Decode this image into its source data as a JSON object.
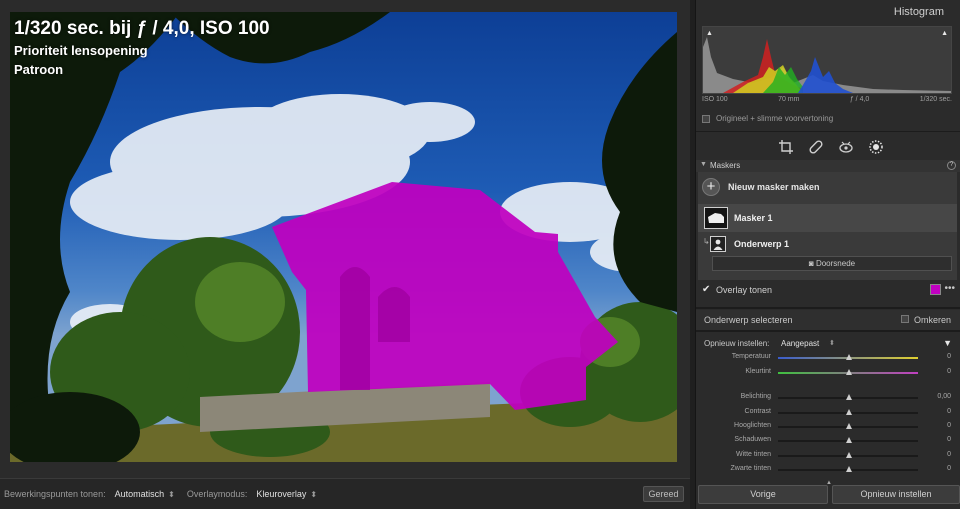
{
  "photo": {
    "exposure": "1/320 sec. bij ƒ / 4,0, ISO 100",
    "mode": "Prioriteit lensopening",
    "pattern": "Patroon",
    "overlay_color": "#c000c0"
  },
  "toolbar": {
    "edit_points_label": "Bewerkingspunten tonen:",
    "edit_points_value": "Automatisch",
    "overlay_mode_label": "Overlaymodus:",
    "overlay_mode_value": "Kleuroverlay",
    "done_label": "Gereed"
  },
  "histogram": {
    "title": "Histogram",
    "iso": "ISO 100",
    "focal": "70 mm",
    "aperture": "ƒ / 4,0",
    "shutter": "1/320 sec.",
    "preview": "Origineel + slimme voorvertoning"
  },
  "masks": {
    "title": "Maskers",
    "help": "?",
    "new_mask": "Nieuw masker maken",
    "mask1": "Masker 1",
    "subject": "Onderwerp 1",
    "intersect": "Doorsnede",
    "overlay_label": "Overlay tonen",
    "overlay_checked": true,
    "more": "•••"
  },
  "subject_select": {
    "label": "Onderwerp selecteren",
    "invert": "Omkeren"
  },
  "adjust": {
    "reset_label": "Opnieuw instellen:",
    "preset": "Aangepast",
    "sliders": [
      {
        "name": "Temperatuur",
        "value": "0",
        "gradient": "linear-gradient(90deg,#3a5ccc,#e0d030)"
      },
      {
        "name": "Kleurtint",
        "value": "0",
        "gradient": "linear-gradient(90deg,#40c040,#c040c0)"
      },
      {
        "name": "Belichting",
        "value": "0,00",
        "gradient": ""
      },
      {
        "name": "Contrast",
        "value": "0",
        "gradient": ""
      },
      {
        "name": "Hooglichten",
        "value": "0",
        "gradient": ""
      },
      {
        "name": "Schaduwen",
        "value": "0",
        "gradient": ""
      },
      {
        "name": "Witte tinten",
        "value": "0",
        "gradient": ""
      },
      {
        "name": "Zwarte tinten",
        "value": "0",
        "gradient": ""
      }
    ]
  },
  "buttons": {
    "previous": "Vorige",
    "reset": "Opnieuw instellen"
  }
}
